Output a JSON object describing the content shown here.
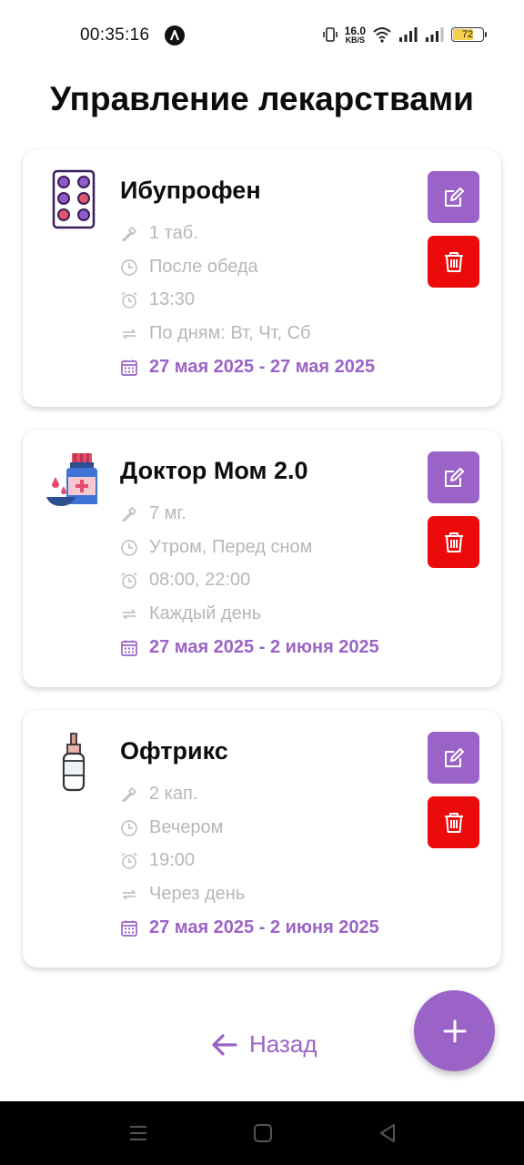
{
  "status_bar": {
    "time": "00:35:16",
    "net_speed_value": "16.0",
    "net_speed_unit": "KB/S",
    "battery": "72",
    "battery_level": 0.72
  },
  "title": "Управление лекарствами",
  "medications": [
    {
      "name": "Ибупрофен",
      "image": "pill-blister-icon",
      "dose": "1 таб.",
      "timing": "После обеда",
      "times": "13:30",
      "repeat": "По дням: Вт, Чт, Сб",
      "dates": "27 мая 2025 - 27 мая 2025"
    },
    {
      "name": "Доктор Мом 2.0",
      "image": "syrup-bottle-icon",
      "dose": "7 мг.",
      "timing": "Утром, Перед сном",
      "times": "08:00, 22:00",
      "repeat": "Каждый день",
      "dates": "27 мая 2025 - 2 июня 2025"
    },
    {
      "name": "Офтрикс",
      "image": "eye-drops-bottle-icon",
      "dose": "2 кап.",
      "timing": "Вечером",
      "times": "19:00",
      "repeat": "Через день",
      "dates": "27 мая 2025 - 2 июня 2025"
    }
  ],
  "back_label": "Назад",
  "colors": {
    "accent": "#9b63c7",
    "delete": "#ec0b0b",
    "muted_text": "#b7b7b7"
  }
}
